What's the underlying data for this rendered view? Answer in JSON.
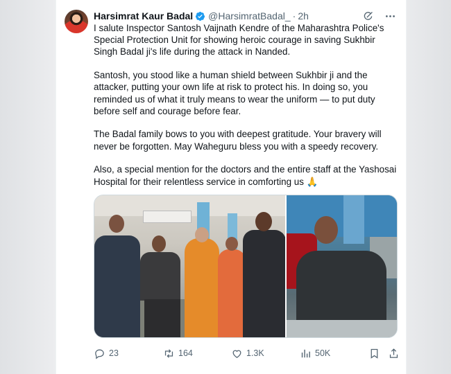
{
  "tweet": {
    "author_name": "Harsimrat Kaur Badal",
    "handle": "@HarsimratBadal_",
    "separator": "·",
    "time": "2h",
    "paragraphs": [
      "I salute Inspector Santosh Vaijnath Kendre of the Maharashtra Police's Special Protection Unit for showing heroic courage in saving Sukhbir Singh Badal ji's life during the attack in Nanded.",
      "Santosh, you stood like a human shield between Sukhbir ji and the attacker, putting your own life at risk to protect his. In doing so, you reminded us of what it truly means to wear the uniform — to put duty before self and courage before fear.",
      "The Badal family bows to you with deepest gratitude. Your bravery will never be forgotten. May Waheguru bless you with a speedy recovery.",
      "Also, a special mention for the doctors and the entire staff at the Yashosai Hospital for their relentless service in comforting us 🙏"
    ]
  },
  "actions": {
    "replies": "23",
    "reposts": "164",
    "likes": "1.3K",
    "views": "50K"
  },
  "icons": {
    "verified": "verified-badge-icon",
    "grok": "grok-icon",
    "more": "more-icon",
    "reply": "reply-icon",
    "repost": "repost-icon",
    "like": "like-icon",
    "views": "views-icon",
    "bookmark": "bookmark-icon",
    "share": "share-icon"
  },
  "colors": {
    "verified_blue": "#1d9bf0",
    "text": "#0f1419",
    "secondary": "#536471"
  }
}
